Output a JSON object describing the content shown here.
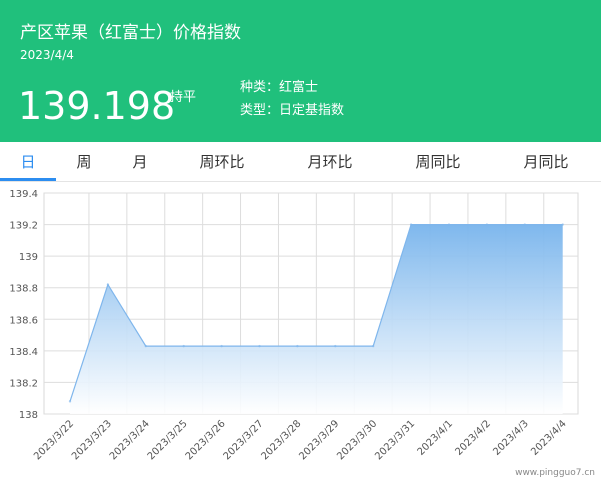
{
  "header": {
    "title": "产区苹果（红富士）价格指数",
    "date": "2023/4/4",
    "price": "139.198",
    "trend": "持平",
    "category_line": "种类：红富士",
    "type_line": "类型：日定基指数"
  },
  "tabs": [
    {
      "label": "日",
      "active": true
    },
    {
      "label": "周",
      "active": false
    },
    {
      "label": "月",
      "active": false
    },
    {
      "label": "周环比",
      "active": false
    },
    {
      "label": "月环比",
      "active": false
    },
    {
      "label": "周同比",
      "active": false
    },
    {
      "label": "月同比",
      "active": false
    }
  ],
  "watermark": "www.pingguo7.cn",
  "colors": {
    "header_bg": "#20c07c",
    "active_tab": "#2c8df0",
    "line": "#7fb6ec",
    "area_top": "#78b4ec",
    "area_bottom": "#ffffff"
  },
  "chart_data": {
    "type": "area",
    "title": "",
    "xlabel": "",
    "ylabel": "",
    "ylim": [
      138,
      139.4
    ],
    "yticks": [
      138,
      138.2,
      138.4,
      138.6,
      138.8,
      139,
      139.2,
      139.4
    ],
    "yticklabels": [
      "138",
      "138.2",
      "138.4",
      "138.6",
      "138.8",
      "139",
      "139.2",
      "139.4"
    ],
    "grid": true,
    "legend": "none",
    "x": [
      "2023/3/22",
      "2023/3/23",
      "2023/3/24",
      "2023/3/25",
      "2023/3/26",
      "2023/3/27",
      "2023/3/28",
      "2023/3/29",
      "2023/3/30",
      "2023/3/31",
      "2023/4/1",
      "2023/4/2",
      "2023/4/3",
      "2023/4/4"
    ],
    "values": [
      138.08,
      138.82,
      138.43,
      138.43,
      138.43,
      138.43,
      138.43,
      138.43,
      138.43,
      139.2,
      139.2,
      139.2,
      139.2,
      139.2
    ]
  }
}
